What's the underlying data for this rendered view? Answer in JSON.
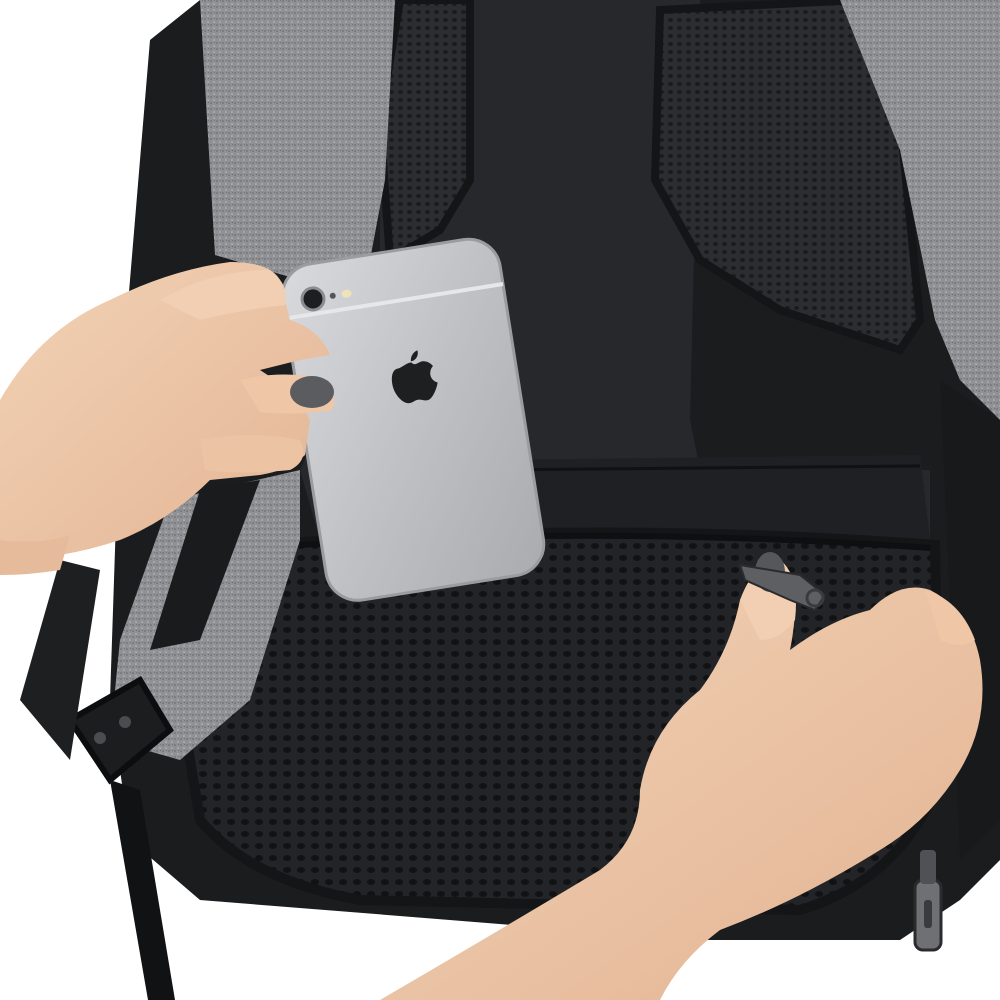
{
  "scene": {
    "subject": "backpack-with-phone-in-hidden-back-pocket",
    "colors": {
      "background": "#ffffff",
      "fabric_dark": "#1b1c1e",
      "fabric_panel": "#26282b",
      "mesh": "#2a2c2f",
      "heather_gray": "#8d8f93",
      "phone_silver": "#c9cbce",
      "skin": "#efc9ab",
      "nail_polish": "#55575b"
    },
    "icons": [
      "apple-logo-icon",
      "zipper-pull-icon"
    ]
  }
}
